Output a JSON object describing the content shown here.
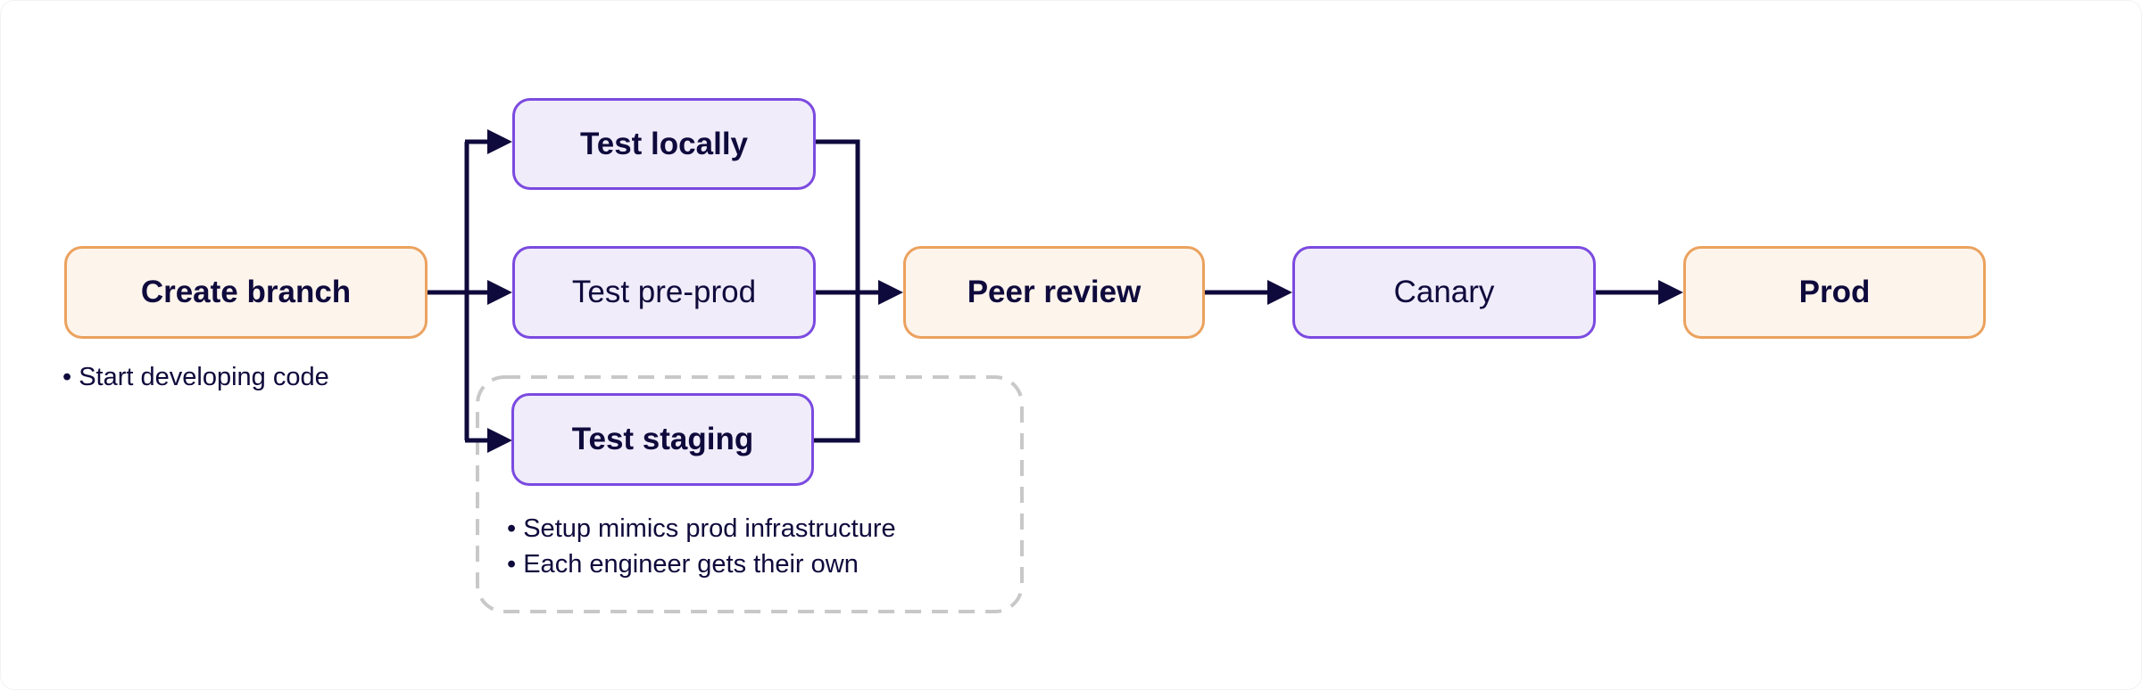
{
  "colors": {
    "line": "#0f0a3c",
    "orange_border": "#eba25e",
    "orange_fill": "#fdf4ec",
    "purple_border": "#7b4ae0",
    "purple_fill": "#f0ecfa",
    "dashed_group": "#c8c8c8"
  },
  "nodes": {
    "create_branch": "Create branch",
    "test_locally": "Test locally",
    "test_preprod": "Test pre-prod",
    "test_staging": "Test staging",
    "peer_review": "Peer review",
    "canary": "Canary",
    "prod": "Prod"
  },
  "notes": {
    "create_branch": [
      "Start developing code"
    ],
    "test_staging": [
      "Setup mimics prod infrastructure",
      "Each engineer gets their own"
    ]
  },
  "edges": [
    [
      "Create branch",
      "Test locally"
    ],
    [
      "Create branch",
      "Test pre-prod"
    ],
    [
      "Create branch",
      "Test staging"
    ],
    [
      "Test locally",
      "Peer review"
    ],
    [
      "Test pre-prod",
      "Peer review"
    ],
    [
      "Test staging",
      "Peer review"
    ],
    [
      "Peer review",
      "Canary"
    ],
    [
      "Canary",
      "Prod"
    ]
  ]
}
